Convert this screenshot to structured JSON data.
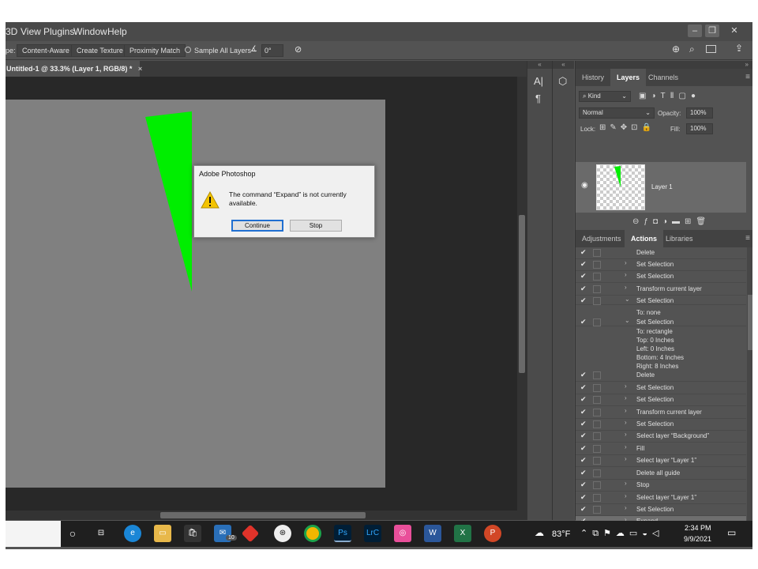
{
  "menu": {
    "items": [
      "3D",
      "View",
      "Plugins",
      "Window",
      "Help"
    ],
    "window_controls": [
      "minimize",
      "restore",
      "close"
    ]
  },
  "options_bar": {
    "prefix": "pe:",
    "content_aware": "Content-Aware",
    "create_texture": "Create Texture",
    "proximity_match": "Proximity Match",
    "sample_all_layers": "Sample All Layers",
    "angle_value": "0°"
  },
  "document": {
    "tab_title": "Untitled-1 @ 33.3% (Layer 1, RGB/8) *",
    "shape_color": "#00ee00"
  },
  "dialog": {
    "title": "Adobe Photoshop",
    "message": "The command “Expand” is not currently available.",
    "continue_label": "Continue",
    "stop_label": "Stop"
  },
  "layers_panel": {
    "tabs": [
      "History",
      "Layers",
      "Channels"
    ],
    "active_tab": "Layers",
    "filter_kind": "Kind",
    "blend_mode": "Normal",
    "opacity_label": "Opacity:",
    "opacity_value": "100%",
    "lock_label": "Lock:",
    "fill_label": "Fill:",
    "fill_value": "100%",
    "layer_name": "Layer 1"
  },
  "actions_panel": {
    "tabs": [
      "Adjustments",
      "Actions",
      "Libraries"
    ],
    "active_tab": "Actions",
    "rows": [
      {
        "name": "Delete",
        "twirl": ""
      },
      {
        "name": "Set Selection",
        "twirl": "›"
      },
      {
        "name": "Set Selection",
        "twirl": "›"
      },
      {
        "name": "Transform current layer",
        "twirl": "›"
      },
      {
        "name": "Set Selection",
        "twirl": "⌄"
      },
      {
        "name": "To: none",
        "twirl": ""
      },
      {
        "name": "Set Selection",
        "twirl": "⌄"
      },
      {
        "name": "To: rectangle",
        "twirl": ""
      },
      {
        "name": "Top: 0 Inches",
        "twirl": ""
      },
      {
        "name": "Left: 0 Inches",
        "twirl": ""
      },
      {
        "name": "Bottom: 4 Inches",
        "twirl": ""
      },
      {
        "name": "Right: 8 Inches",
        "twirl": ""
      },
      {
        "name": "Delete",
        "twirl": ""
      },
      {
        "name": "Set Selection",
        "twirl": "›"
      },
      {
        "name": "Set Selection",
        "twirl": "›"
      },
      {
        "name": "Transform current layer",
        "twirl": "›"
      },
      {
        "name": "Set Selection",
        "twirl": "›"
      },
      {
        "name": "Select layer “Background”",
        "twirl": "›"
      },
      {
        "name": "Fill",
        "twirl": "›"
      },
      {
        "name": "Select layer “Layer 1”",
        "twirl": "›"
      },
      {
        "name": "Delete all guide",
        "twirl": ""
      },
      {
        "name": "Stop",
        "twirl": "›"
      },
      {
        "name": "Select layer “Layer 1”",
        "twirl": "›"
      },
      {
        "name": "Set Selection",
        "twirl": "›"
      },
      {
        "name": "Expand",
        "twirl": "›"
      }
    ]
  },
  "taskbar": {
    "mail_badge": "10",
    "weather": "83°F",
    "time": "2:34 PM",
    "date": "9/9/2021",
    "apps": [
      "Ps",
      "LrC"
    ]
  }
}
